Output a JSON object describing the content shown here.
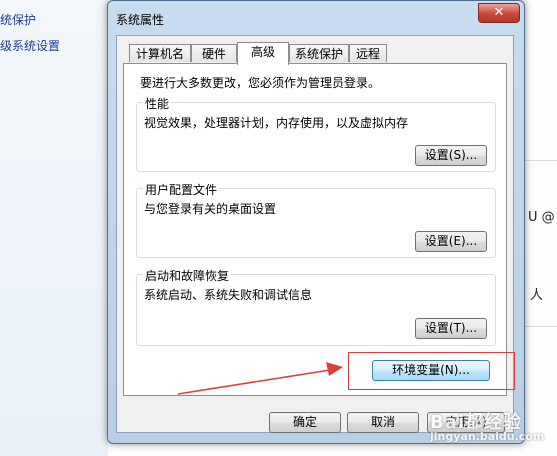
{
  "background": {
    "left_links": [
      "统保护",
      "级系统设置"
    ],
    "right_fragments": [
      "U @",
      "人"
    ]
  },
  "dialog": {
    "title": "系统属性",
    "close_glyph": "✕",
    "tabs": [
      "计算机名",
      "硬件",
      "高级",
      "系统保护",
      "远程"
    ],
    "active_tab": "高级",
    "admin_note": "要进行大多数更改，您必须作为管理员登录。",
    "groups": [
      {
        "title": "性能",
        "desc": "视觉效果，处理器计划，内存使用，以及虚拟内存",
        "button": "设置(S)..."
      },
      {
        "title": "用户配置文件",
        "desc": "与您登录有关的桌面设置",
        "button": "设置(E)..."
      },
      {
        "title": "启动和故障恢复",
        "desc": "系统启动、系统失败和调试信息",
        "button": "设置(T)..."
      }
    ],
    "env_button": "环境变量(N)...",
    "footer": {
      "ok": "确定",
      "cancel": "取消",
      "apply": "应用(A)"
    }
  },
  "annotation": {
    "color": "#e13c3c"
  },
  "watermark": {
    "line1": "Bai都经验",
    "line2": "jingyan.baidu.com"
  }
}
